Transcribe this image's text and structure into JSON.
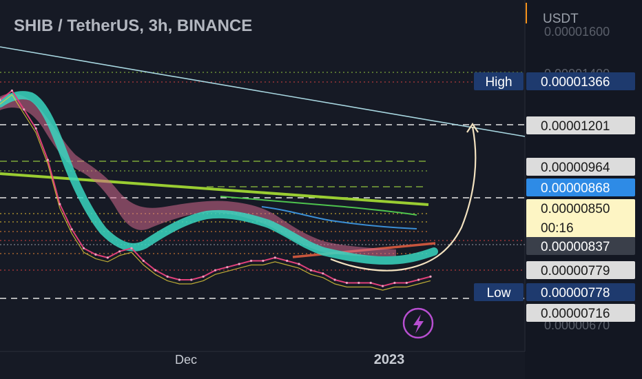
{
  "symbol_title": "SHIB / TetherUS, 3h, BINANCE",
  "currency_label": "USDT",
  "colors": {
    "background": "#161a25",
    "axis_panel": "#131722",
    "trendline_cyan": "#a9d8e2",
    "trendline_green": "#9acd32",
    "trendline_orange": "#c8553d",
    "cloud_teal": "#38d6c0",
    "cloud_pink": "#d46a8e",
    "arrow_cream": "#f3e2c0",
    "label_navy": "#1e3a6e",
    "label_blue": "#2e8be6",
    "label_yellow": "#fdf5c4",
    "label_gray": "#dcdcdc",
    "label_dark": "#3a3f4a",
    "lightning_purple": "#b84fd1"
  },
  "chart_data": {
    "type": "line",
    "title": "SHIB / TetherUS, 3h, BINANCE",
    "ylabel": "USDT",
    "y_unit": "USDT",
    "ylim": [
      6.6e-06,
      1.6e-05
    ],
    "x_ticks": [
      "Dec",
      "2023"
    ],
    "series": [
      {
        "name": "",
        "values": [
          1.37e-05,
          1.4e-05,
          1.34e-05,
          1.28e-05,
          1.18e-05,
          1.04e-05,
          9.6e-06,
          9e-06,
          8.8e-06,
          8.7e-06,
          8.9e-06,
          9e-06,
          8.6e-06,
          8.3e-06,
          8.1e-06,
          8e-06,
          8e-06,
          8.1e-06,
          8.3e-06,
          8.4e-06,
          8.5e-06,
          8.6e-06,
          8.6e-06,
          8.7e-06,
          8.6e-06,
          8.5e-06,
          8.3e-06,
          8.2e-06,
          8e-06,
          7.9e-06,
          7.9e-06,
          7.9e-06,
          7.8e-06,
          7.9e-06,
          7.9e-06,
          8e-06,
          8.1e-06
        ]
      }
    ],
    "price_levels": [
      {
        "label": "High",
        "value": "0.00001366",
        "style": "navy"
      },
      {
        "label": "",
        "value": "0.00001201",
        "style": "gray"
      },
      {
        "label": "",
        "value": "0.00000964",
        "style": "gray"
      },
      {
        "label": "",
        "value": "0.00000868",
        "style": "blue"
      },
      {
        "label": "",
        "value": "0.00000850",
        "countdown": "00:16",
        "style": "yellow"
      },
      {
        "label": "",
        "value": "0.00000837",
        "style": "dark"
      },
      {
        "label": "",
        "value": "0.00000779",
        "style": "gray"
      },
      {
        "label": "Low",
        "value": "0.00000778",
        "style": "navy"
      },
      {
        "label": "",
        "value": "0.00000716",
        "style": "gray"
      }
    ],
    "grid": false,
    "legend": "none"
  },
  "icons": {
    "lightning": "lightning-icon"
  }
}
